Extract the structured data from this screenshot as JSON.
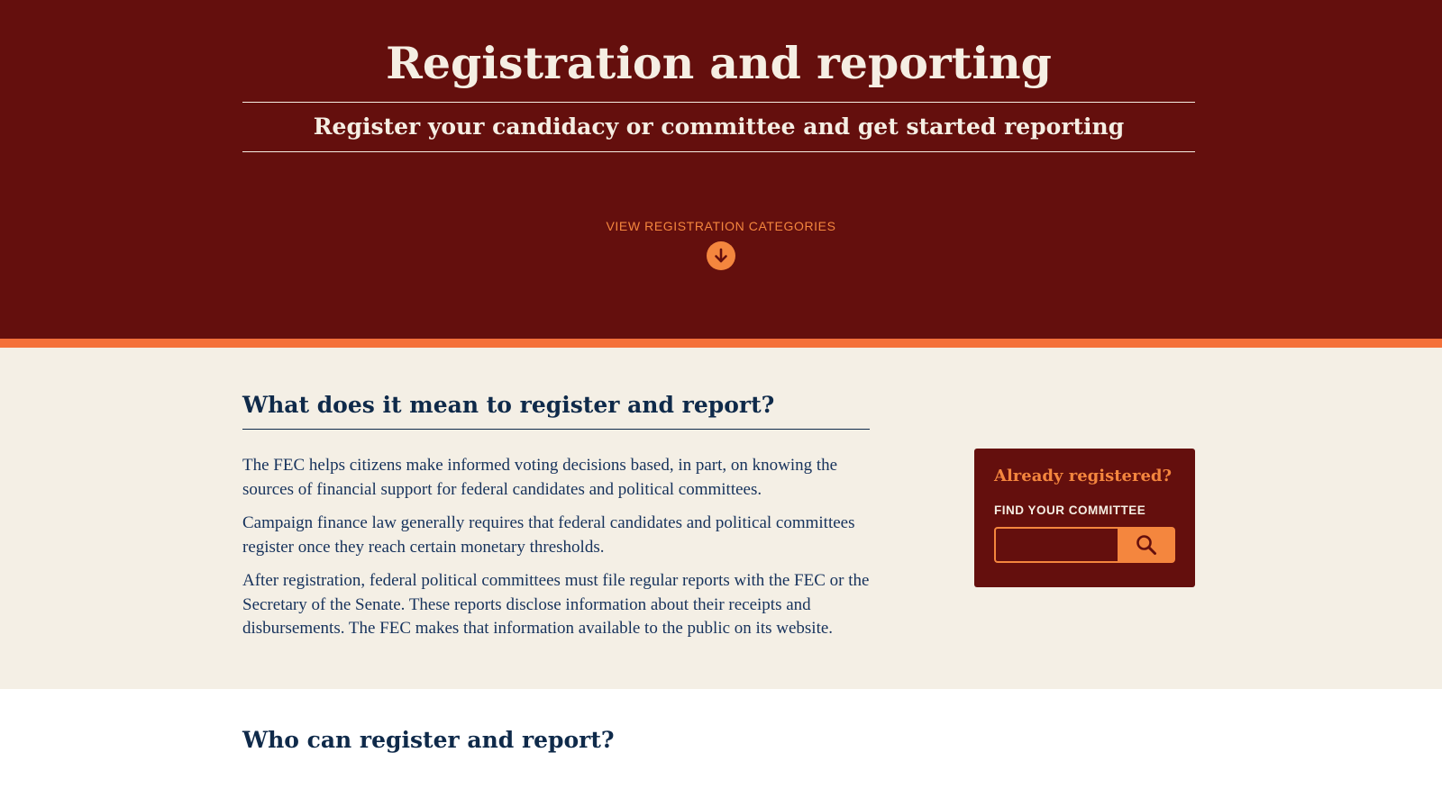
{
  "hero": {
    "title": "Registration and reporting",
    "subtitle": "Register your candidacy or committee and get started reporting",
    "cta_label": "VIEW REGISTRATION CATEGORIES",
    "cta_icon": "arrow-down-circle-icon"
  },
  "intro": {
    "heading": "What does it mean to register and report?",
    "paragraphs": [
      "The FEC helps citizens make informed voting decisions based, in part, on knowing the sources of financial support for federal candidates and political committees.",
      "Campaign finance law generally requires that federal candidates and political committees register once they reach certain monetary thresholds.",
      "After registration, federal political committees must file regular reports with the FEC or the Secretary of the Senate. These reports disclose information about their receipts and disbursements. The FEC makes that information available to the public on its website."
    ]
  },
  "registered_box": {
    "title": "Already registered?",
    "label": "FIND YOUR COMMITTEE",
    "input_value": "",
    "search_icon": "search-icon"
  },
  "who": {
    "heading": "Who can register and report?"
  },
  "colors": {
    "hero_bg": "#640f0d",
    "accent_orange": "#f4863e",
    "divider_orange": "#f4713a",
    "intro_bg": "#f4efe5",
    "navy_text": "#0f2a4a",
    "cream_text": "#f5eee3"
  }
}
